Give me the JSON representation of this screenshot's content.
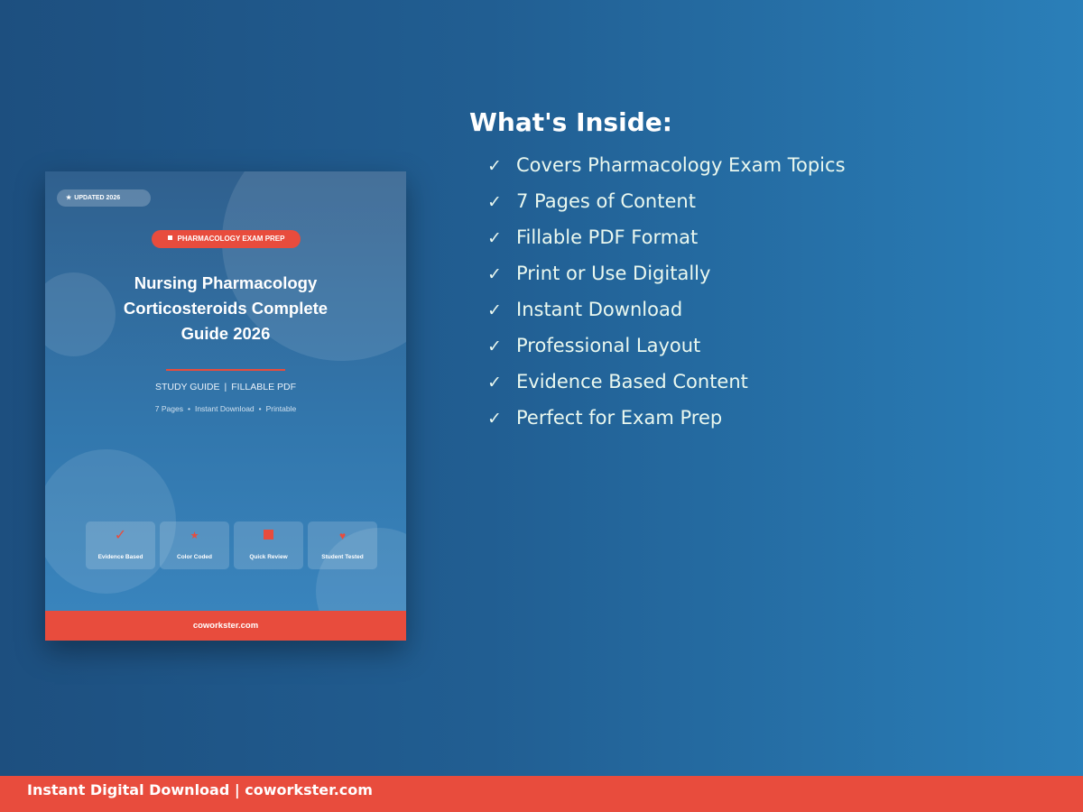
{
  "cover": {
    "updated_badge": "UPDATED 2026",
    "category": "PHARMACOLOGY EXAM PREP",
    "title_lines": [
      "Nursing Pharmacology",
      "Corticosteroids Complete",
      "Guide 2026"
    ],
    "subtitle": {
      "type": "STUDY GUIDE",
      "separator": "|",
      "format": "FILLABLE PDF"
    },
    "meta": [
      "7 Pages",
      "Instant Download",
      "Printable"
    ],
    "features": [
      {
        "label": "Evidence Based",
        "icon": "check-icon"
      },
      {
        "label": "Color Coded",
        "icon": "star-icon"
      },
      {
        "label": "Quick Review",
        "icon": "square-icon"
      },
      {
        "label": "Student Tested",
        "icon": "heart-icon"
      }
    ],
    "footer": "coworkster.com"
  },
  "inside": {
    "heading": "What's Inside:",
    "items": [
      "Covers Pharmacology Exam Topics",
      "7 Pages of Content",
      "Fillable PDF Format",
      "Print or Use Digitally",
      "Instant Download",
      "Professional Layout",
      "Evidence Based Content",
      "Perfect for Exam Prep"
    ]
  },
  "banner": {
    "text": "Instant Digital Download | coworkster.com"
  },
  "colors": {
    "accent": "#e84c3d",
    "background_left": "#1d4f7f",
    "background_right": "#2a7fb9",
    "check_text": "#eaf8ef"
  }
}
